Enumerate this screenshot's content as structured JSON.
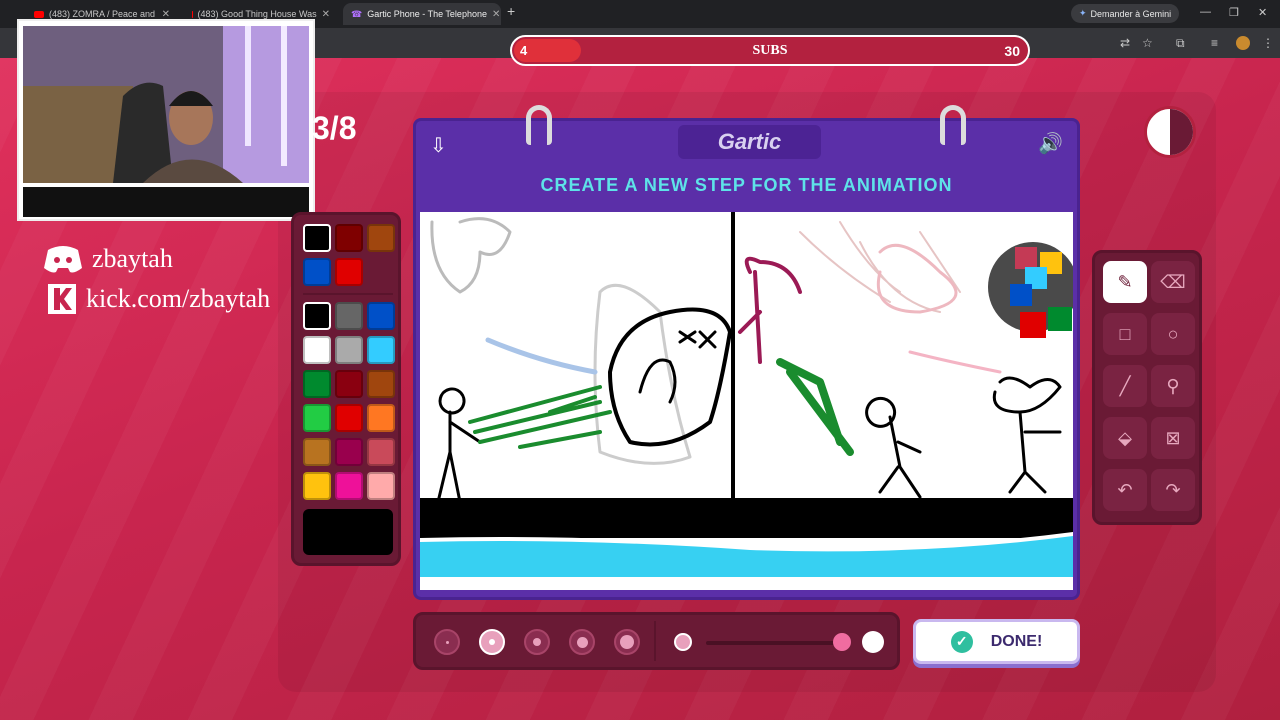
{
  "browser": {
    "tabs": [
      {
        "title": "(483) ZOMRA / Peace and",
        "active": false
      },
      {
        "title": "(483) Good Thing House Was",
        "active": false
      },
      {
        "title": "Gartic Phone - The Telephone",
        "active": true
      }
    ],
    "new_tab": "+",
    "gemini_label": "Demander à Gemini"
  },
  "overlay": {
    "subs_current": "4",
    "subs_label": "SUBS",
    "subs_goal": "30",
    "subs_progress": 0.13,
    "discord": "zbaytah",
    "kick": "kick.com/zbaytah"
  },
  "game": {
    "page_number": "3/8",
    "logo": "Gartic",
    "prompt": "CREATE A NEW STEP FOR THE ANIMATION",
    "done_label": "DONE!",
    "timer_progress": 0.5,
    "palette_top": [
      "#000000",
      "#7f0000",
      "#a0460e",
      "#0050c8",
      "#e00000"
    ],
    "palette_main": [
      "#000000",
      "#666666",
      "#0050c8",
      "#ffffff",
      "#aaaaaa",
      "#33ccff",
      "#008a2e",
      "#8a0010",
      "#a0460e",
      "#22cc44",
      "#e00000",
      "#ff7722",
      "#b87320",
      "#99004d",
      "#c94a5a",
      "#ffc20e",
      "#ee1199",
      "#ffaaaa"
    ],
    "selected_color": "#000000",
    "tools": [
      "pencil-icon",
      "eraser-icon",
      "rectangle-icon",
      "ellipse-icon",
      "line-icon",
      "eyedropper-icon",
      "fill-icon",
      "clear-icon",
      "undo-icon",
      "redo-icon"
    ]
  }
}
